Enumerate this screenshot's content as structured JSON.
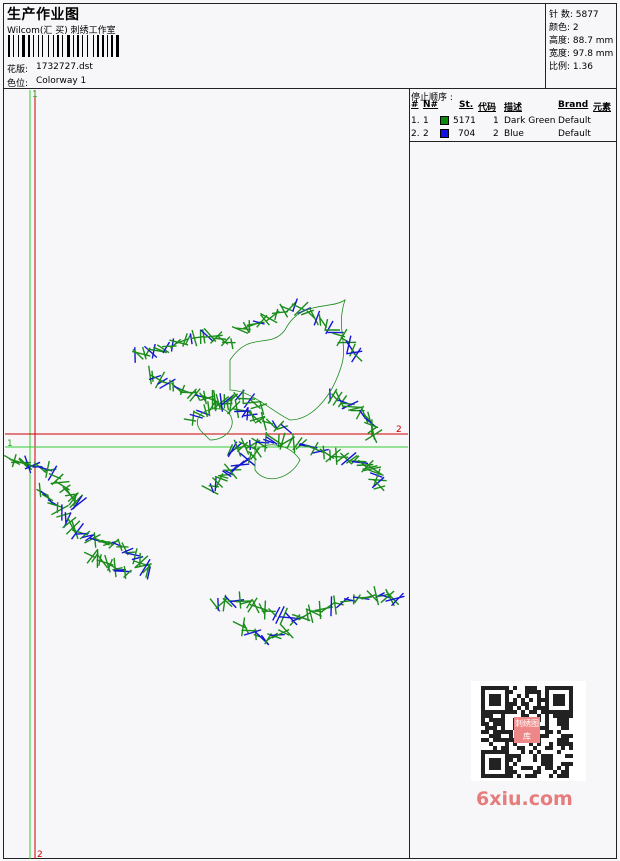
{
  "header": {
    "title": "生产作业图",
    "company": "Wilcom(汇 买) 刺绣工作室",
    "design_label": "花版:",
    "design_file": "1732727.dst",
    "colorway_label": "色位:",
    "colorway": "Colorway 1"
  },
  "stats": {
    "stitches": "针 数: 5877",
    "colors": "颜色: 2",
    "height": "高度: 88.7 mm",
    "width": "宽度: 97.8 mm",
    "scale": "比例: 1.36"
  },
  "stop_sequence": {
    "label": "停止顺序 :",
    "columns": [
      "#",
      "N#",
      "St.",
      "代码",
      "描述",
      "Brand",
      "元素"
    ],
    "rows": [
      {
        "idx": "1.",
        "n": "1",
        "stitches": "5171",
        "code": "1",
        "desc": "Dark Green",
        "brand": "Default",
        "color": "#0a8a0a"
      },
      {
        "idx": "2.",
        "n": "2",
        "stitches": "704",
        "code": "2",
        "desc": "Blue",
        "brand": "Default",
        "color": "#1010e0"
      }
    ]
  },
  "markers": {
    "v1_top": "1",
    "v2_bottom": "2",
    "h1_left": "1",
    "h2_right": "2"
  },
  "watermark": {
    "site": "6xiu.com",
    "qr_badge": "刺绣图库"
  },
  "colors": {
    "green": "#1a8c1a",
    "blue": "#1515d6",
    "red": "#cc0000",
    "guide_green": "#33cc33"
  }
}
